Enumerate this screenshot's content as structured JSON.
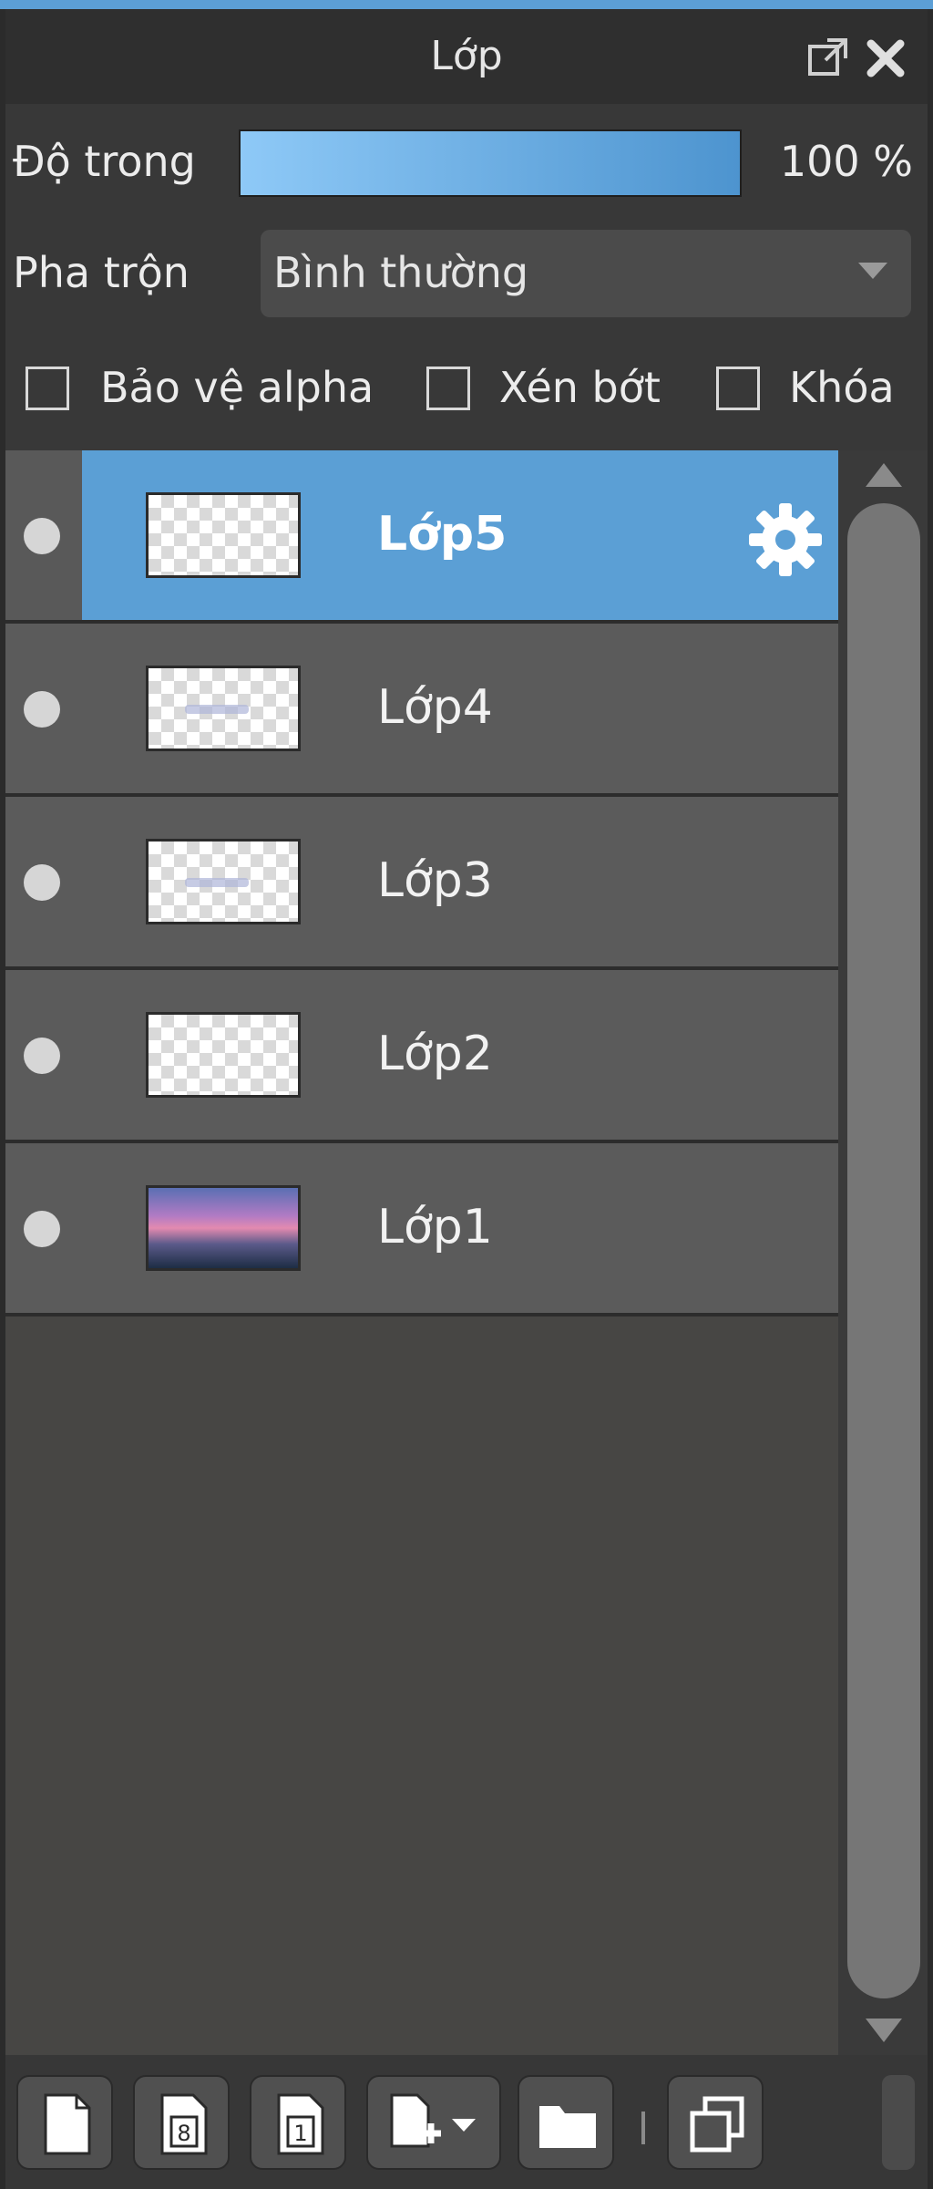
{
  "panel": {
    "title": "Lớp"
  },
  "opacity": {
    "label": "Độ trong",
    "value_text": "100 %",
    "value": 100
  },
  "blend": {
    "label": "Pha trộn",
    "value": "Bình thường"
  },
  "options": [
    {
      "label": "Bảo vệ alpha",
      "checked": false
    },
    {
      "label": "Xén bớt",
      "checked": false
    },
    {
      "label": "Khóa",
      "checked": false
    }
  ],
  "layers": [
    {
      "name": "Lớp5",
      "selected": true
    },
    {
      "name": "Lớp4",
      "selected": false
    },
    {
      "name": "Lớp3",
      "selected": false
    },
    {
      "name": "Lớp2",
      "selected": false
    },
    {
      "name": "Lớp1",
      "selected": false
    }
  ],
  "toolbar": {
    "buttons": [
      {
        "icon": "new-layer-icon"
      },
      {
        "icon": "new-8bit-layer-icon"
      },
      {
        "icon": "new-1bit-layer-icon"
      },
      {
        "icon": "add-layer-menu-icon"
      },
      {
        "icon": "folder-icon"
      },
      {
        "icon": "duplicate-layer-icon"
      }
    ]
  },
  "colors": {
    "accent": "#5b9fd5",
    "panel_bg": "#474644",
    "row_bg": "#5b5b5b"
  }
}
